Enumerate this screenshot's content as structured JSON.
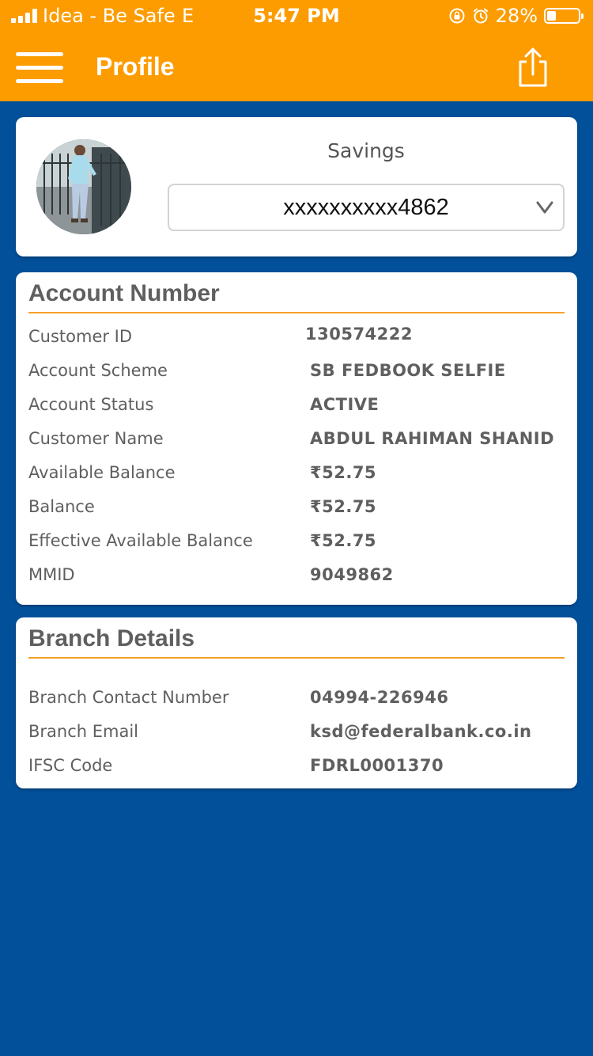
{
  "status_bar": {
    "carrier": "Idea - Be Safe",
    "network": "E",
    "time": "5:47 PM",
    "battery": "28%",
    "battery_level": 0.28,
    "icons": [
      "signal-icon",
      "orientation-lock-icon",
      "alarm-icon",
      "battery-icon"
    ]
  },
  "header": {
    "title": "Profile",
    "icons": [
      "hamburger-menu-icon",
      "share-icon"
    ],
    "background": "#fd9c01"
  },
  "profile": {
    "account_type": "Savings",
    "selected_account": "xxxxxxxxxx4862",
    "icons": [
      "avatar-photo",
      "chevron-down-icon"
    ]
  },
  "account": {
    "heading": "Account Number",
    "rows": [
      {
        "label": "Customer ID",
        "value": "130574222"
      },
      {
        "label": "Account Scheme",
        "value": "SB FEDBOOK SELFIE"
      },
      {
        "label": "Account Status",
        "value": "ACTIVE"
      },
      {
        "label": "Customer Name",
        "value": "ABDUL RAHIMAN SHANID"
      },
      {
        "label": "Available Balance",
        "value": "₹52.75"
      },
      {
        "label": "Balance",
        "value": "₹52.75"
      },
      {
        "label": "Effective Available Balance",
        "value": "₹52.75"
      },
      {
        "label": "MMID",
        "value": "9049862"
      }
    ]
  },
  "branch": {
    "heading": "Branch Details",
    "rows": [
      {
        "label": "Branch Contact Number",
        "value": "04994-226946"
      },
      {
        "label": "Branch Email",
        "value": "ksd@federalbank.co.in"
      },
      {
        "label": "IFSC Code",
        "value": "FDRL0001370"
      }
    ]
  },
  "colors": {
    "accent": "#fd9c01",
    "background": "#02509a",
    "divider": "#f4a12c",
    "text": "#5f5f5f"
  }
}
